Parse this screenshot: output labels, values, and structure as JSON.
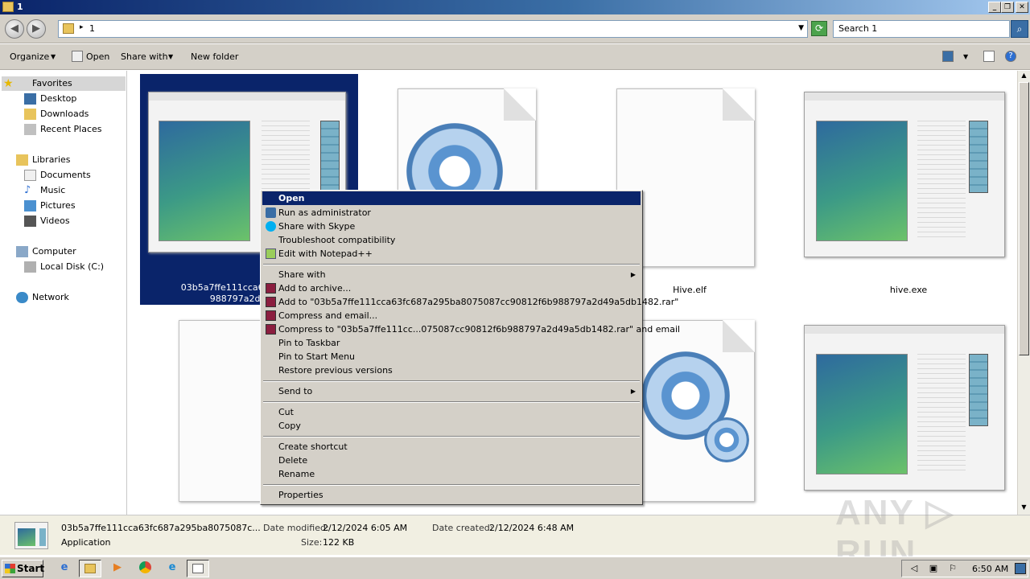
{
  "window": {
    "title": "1"
  },
  "address": {
    "path": "1",
    "search_placeholder": "Search 1"
  },
  "toolbar": {
    "organize": "Organize",
    "open": "Open",
    "share_with": "Share with",
    "new_folder": "New folder"
  },
  "nav": {
    "favorites": "Favorites",
    "desktop": "Desktop",
    "downloads": "Downloads",
    "recent_places": "Recent Places",
    "libraries": "Libraries",
    "documents": "Documents",
    "music": "Music",
    "pictures": "Pictures",
    "videos": "Videos",
    "computer": "Computer",
    "local_disk": "Local Disk (C:)",
    "network": "Network"
  },
  "files": [
    {
      "name_line1": "03b5a7ffe111cca63fc687a295",
      "name_line2": "988797a2d49a5c",
      "icon": "application-window-icon",
      "selected": true
    },
    {
      "name": "",
      "icon": "gear-file-icon"
    },
    {
      "name": "Hive.elf",
      "icon": "blank-file-icon"
    },
    {
      "name": "hive.exe",
      "icon": "application-window-icon"
    },
    {
      "name": "",
      "icon": "blank-file-icon"
    },
    {
      "name": "",
      "icon": "gear-file-icon"
    },
    {
      "name": "",
      "icon": "application-window-icon"
    }
  ],
  "context_menu": {
    "items": [
      {
        "label": "Open",
        "icon": "",
        "highlighted": true
      },
      {
        "label": "Run as administrator",
        "icon": "shield-icon"
      },
      {
        "label": "Share with Skype",
        "icon": "skype-icon"
      },
      {
        "label": "Troubleshoot compatibility",
        "icon": ""
      },
      {
        "label": "Edit with Notepad++",
        "icon": "notepad-plus-icon"
      },
      {
        "label": "Share with",
        "icon": "",
        "submenu": true
      },
      {
        "label": "Add to archive...",
        "icon": "winrar-icon"
      },
      {
        "label": "Add to \"03b5a7ffe111cca63fc687a295ba8075087cc90812f6b988797a2d49a5db1482.rar\"",
        "icon": "winrar-icon"
      },
      {
        "label": "Compress and email...",
        "icon": "winrar-icon"
      },
      {
        "label": "Compress to \"03b5a7ffe111cc...075087cc90812f6b988797a2d49a5db1482.rar\" and email",
        "icon": "winrar-icon"
      },
      {
        "label": "Pin to Taskbar",
        "icon": ""
      },
      {
        "label": "Pin to Start Menu",
        "icon": ""
      },
      {
        "label": "Restore previous versions",
        "icon": ""
      },
      {
        "label": "Send to",
        "icon": "",
        "submenu": true
      },
      {
        "label": "Cut",
        "icon": ""
      },
      {
        "label": "Copy",
        "icon": ""
      },
      {
        "label": "Create shortcut",
        "icon": ""
      },
      {
        "label": "Delete",
        "icon": ""
      },
      {
        "label": "Rename",
        "icon": ""
      },
      {
        "label": "Properties",
        "icon": ""
      }
    ]
  },
  "details": {
    "filename": "03b5a7ffe111cca63fc687a295ba8075087c...",
    "type": "Application",
    "date_modified_label": "Date modified:",
    "date_modified": "2/12/2024 6:05 AM",
    "date_created_label": "Date created:",
    "date_created": "2/12/2024 6:48 AM",
    "size_label": "Size:",
    "size": "122 KB"
  },
  "taskbar": {
    "start": "Start",
    "clock": "6:50 AM"
  },
  "watermark": "ANY RUN"
}
